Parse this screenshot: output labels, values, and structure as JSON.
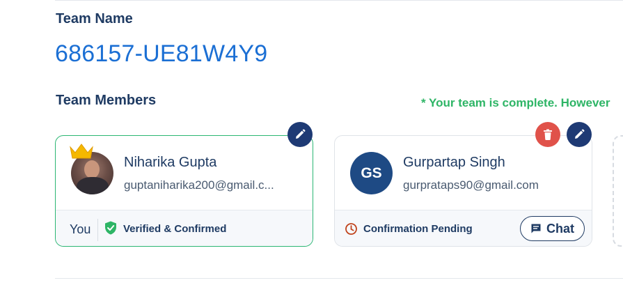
{
  "team": {
    "name_label": "Team Name",
    "name_value": "686157-UE81W4Y9",
    "members_label": "Team Members",
    "notice": "* Your team is complete. However"
  },
  "members": [
    {
      "name": "Niharika Gupta",
      "email": "guptaniharika200@gmail.c...",
      "footer_self": "You",
      "status": "Verified & Confirmed",
      "role_icon": "crown-icon",
      "status_icon": "shield-check-icon"
    },
    {
      "name": "Gurpartap Singh",
      "initials": "GS",
      "email": "gurprataps90@gmail.com",
      "status": "Confirmation Pending",
      "status_icon": "clock-icon",
      "chat_label": "Chat"
    }
  ],
  "colors": {
    "accent_blue": "#1b6fd4",
    "navy": "#1e3a74",
    "success_green": "#2eb566",
    "danger_red": "#e0524a",
    "pending_orange": "#c0431c"
  }
}
